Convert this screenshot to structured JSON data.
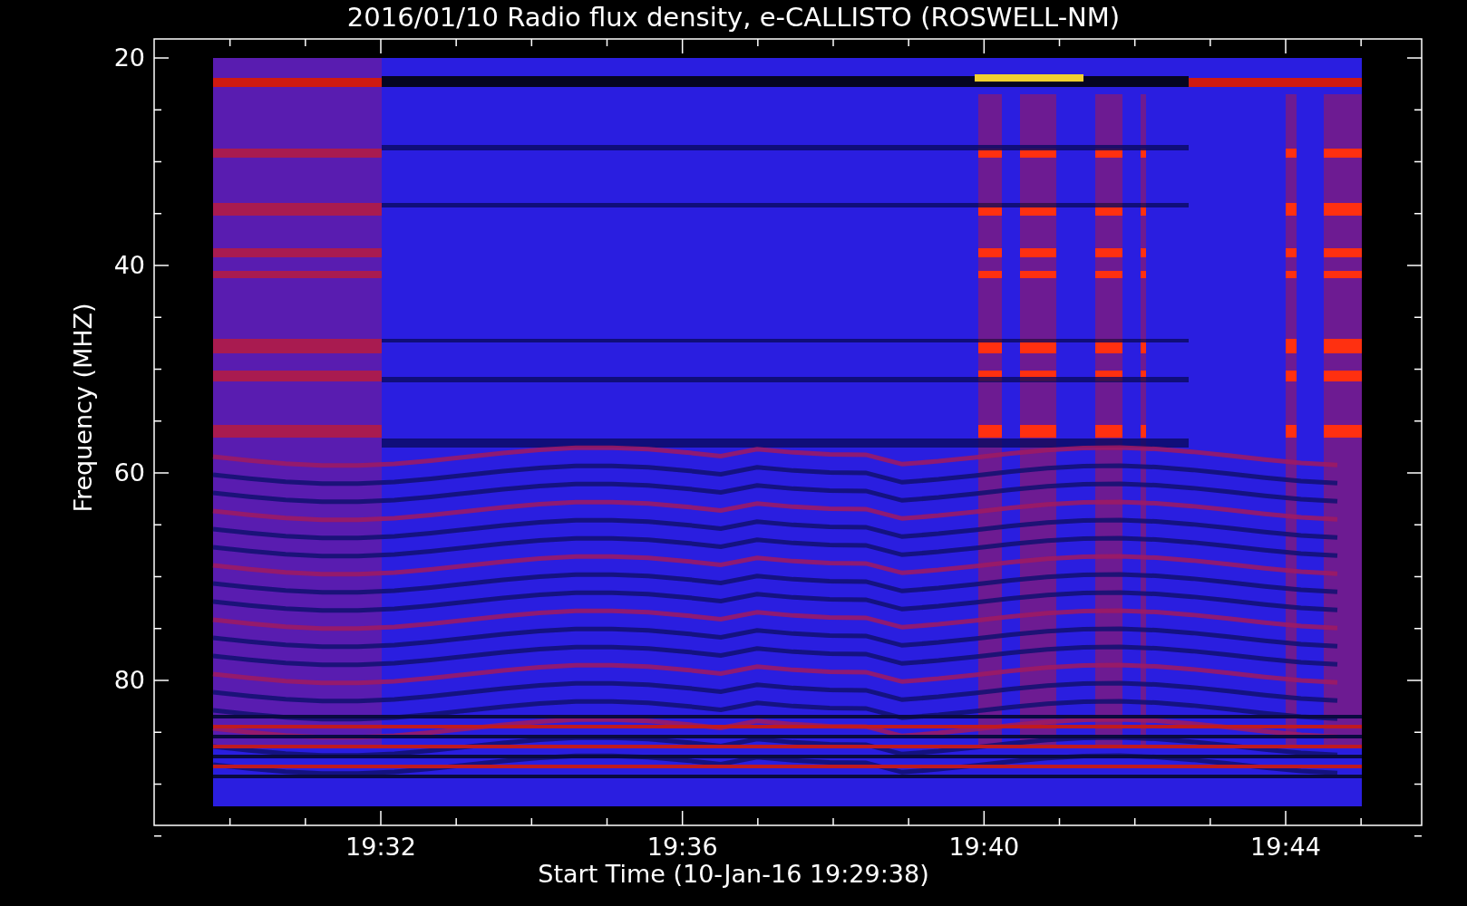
{
  "title": "2016/01/10  Radio flux density, e-CALLISTO (ROSWELL-NM)",
  "y_axis": {
    "label": "Frequency (MHZ)",
    "ticks": [
      "20",
      "40",
      "60",
      "80"
    ]
  },
  "x_axis": {
    "label": "Start Time (10-Jan-16 19:29:38)",
    "ticks": [
      "19:32",
      "19:36",
      "19:40",
      "19:44"
    ]
  }
}
